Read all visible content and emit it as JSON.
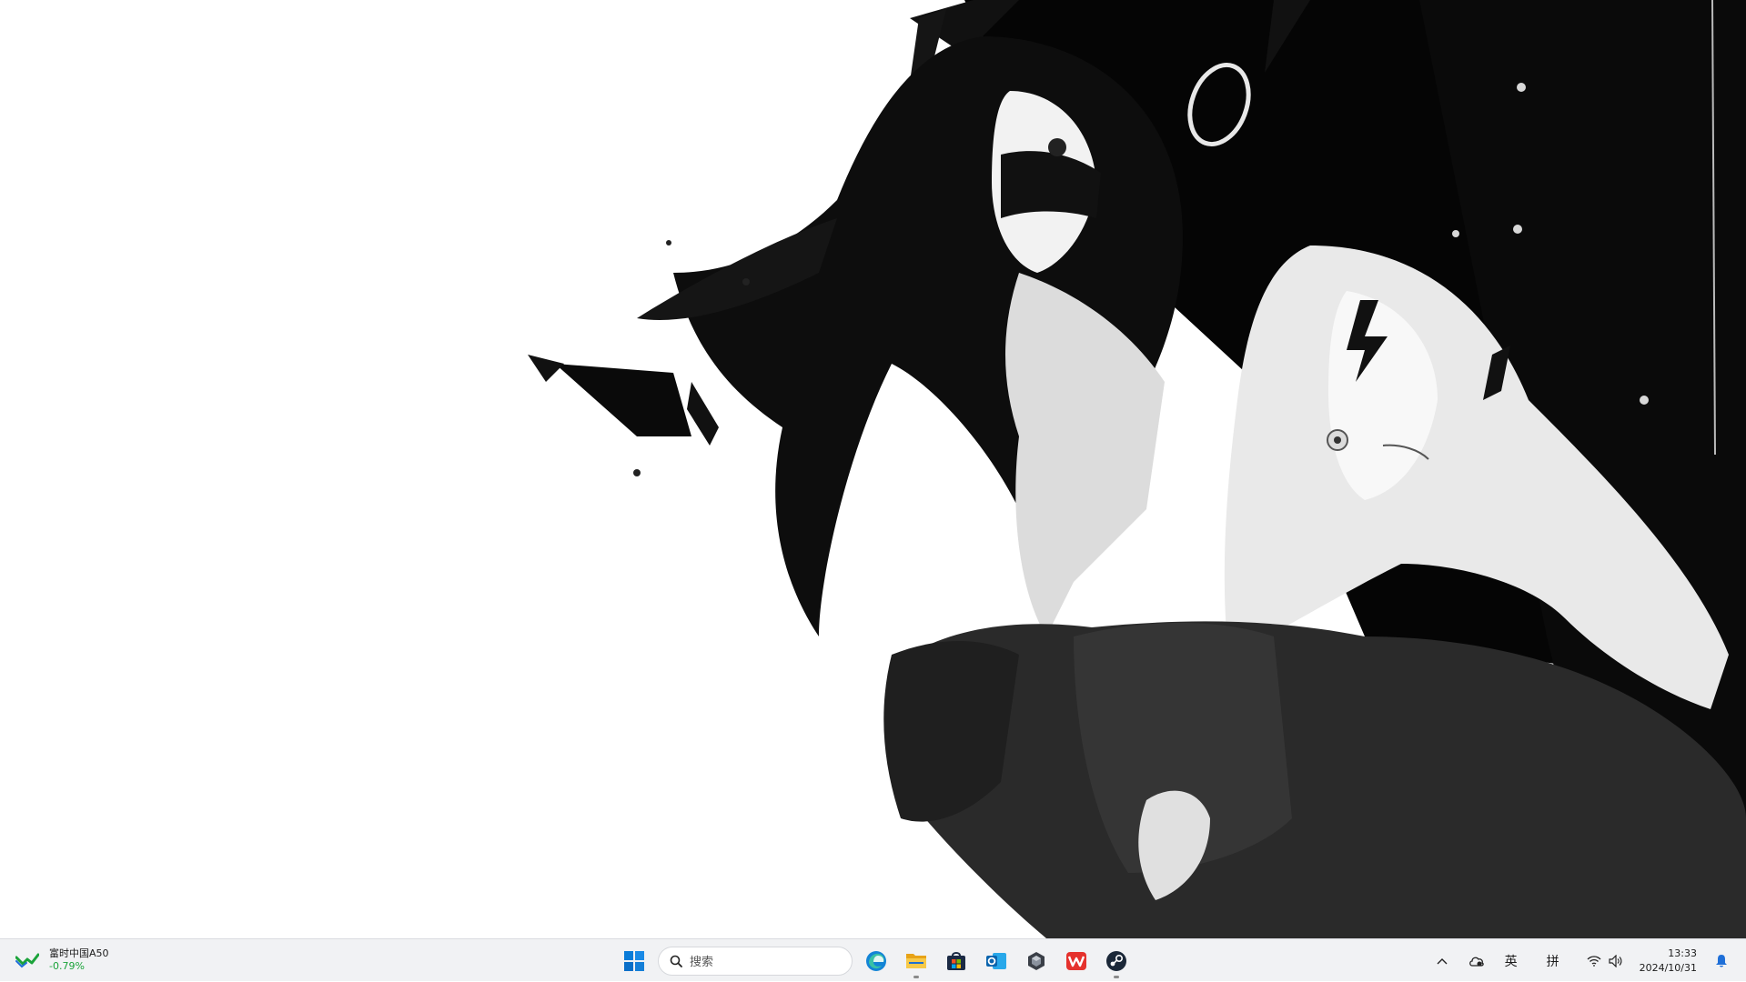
{
  "taskbar": {
    "widget": {
      "title": "富时中国A50",
      "change": "-0.79%",
      "icon": "stock-chart-icon"
    },
    "search": {
      "placeholder": "搜索"
    },
    "pinned_apps": [
      {
        "name": "start-button",
        "icon": "windows-logo-icon"
      },
      {
        "name": "edge",
        "icon": "edge-icon"
      },
      {
        "name": "file-explorer",
        "icon": "folder-icon"
      },
      {
        "name": "microsoft-store",
        "icon": "store-icon"
      },
      {
        "name": "outlook",
        "icon": "outlook-icon"
      },
      {
        "name": "unity-hub",
        "icon": "cube-icon"
      },
      {
        "name": "wps-office",
        "icon": "wps-icon"
      },
      {
        "name": "steam",
        "icon": "steam-icon"
      }
    ],
    "tray": {
      "ime_lang": "英",
      "ime_mode": "拼",
      "time": "13:33",
      "date": "2024/10/31"
    }
  },
  "colors": {
    "accent_blue": "#0067c0",
    "taskbar_bg": "#f1f2f4",
    "stock_green": "#1aa33a"
  }
}
